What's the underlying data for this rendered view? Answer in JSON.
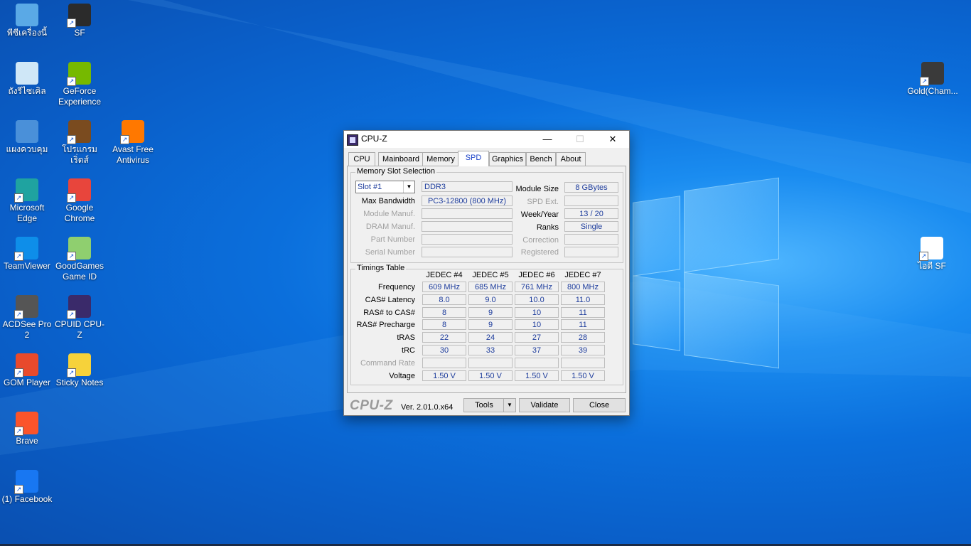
{
  "desktop": {
    "icons": [
      {
        "label": "พีซีเครื่องนี้",
        "icon": "computer-icon"
      },
      {
        "label": "SF",
        "icon": "sf-game-icon"
      },
      {
        "label": "ถังรีไซเคิล",
        "icon": "recycle-bin-icon"
      },
      {
        "label": "GeForce Experience",
        "icon": "geforce-icon"
      },
      {
        "label": "แผงควบคุม",
        "icon": "control-panel-icon"
      },
      {
        "label": "โปรแกรม เริ่ดส์",
        "icon": "program-icon"
      },
      {
        "label": "Avast Free Antivirus",
        "icon": "avast-icon"
      },
      {
        "label": "Microsoft Edge",
        "icon": "edge-icon"
      },
      {
        "label": "Google Chrome",
        "icon": "chrome-icon"
      },
      {
        "label": "TeamViewer",
        "icon": "teamviewer-icon"
      },
      {
        "label": "GoodGames Game ID",
        "icon": "goodgames-icon"
      },
      {
        "label": "ACDSee Pro 2",
        "icon": "acdsee-icon"
      },
      {
        "label": "CPUID CPU-Z",
        "icon": "cpuz-icon"
      },
      {
        "label": "GOM Player",
        "icon": "gom-player-icon"
      },
      {
        "label": "Sticky Notes",
        "icon": "sticky-notes-icon"
      },
      {
        "label": "Brave",
        "icon": "brave-icon"
      },
      {
        "label": "(1) Facebook",
        "icon": "facebook-icon"
      },
      {
        "label": "Gold(Cham...",
        "icon": "gold-game-icon"
      },
      {
        "label": "ไอดี SF",
        "icon": "text-file-icon"
      }
    ]
  },
  "window": {
    "title": "CPU-Z",
    "controls": {
      "minimize": "—",
      "maximize": "☐",
      "close": "✕"
    },
    "tabs": [
      "CPU",
      "Mainboard",
      "Memory",
      "SPD",
      "Graphics",
      "Bench",
      "About"
    ],
    "active_tab": "SPD"
  },
  "slot": {
    "group_title": "Memory Slot Selection",
    "selected": "Slot #1",
    "type": "DDR3",
    "max_bandwidth_label": "Max Bandwidth",
    "max_bandwidth": "PC3-12800 (800 MHz)",
    "module_manuf_label": "Module Manuf.",
    "dram_manuf_label": "DRAM Manuf.",
    "part_number_label": "Part Number",
    "serial_number_label": "Serial Number",
    "module_size_label": "Module Size",
    "module_size": "8 GBytes",
    "spd_ext_label": "SPD Ext.",
    "week_year_label": "Week/Year",
    "week_year": "13 / 20",
    "ranks_label": "Ranks",
    "ranks": "Single",
    "correction_label": "Correction",
    "registered_label": "Registered"
  },
  "timings": {
    "group_title": "Timings Table",
    "columns": [
      "JEDEC #4",
      "JEDEC #5",
      "JEDEC #6",
      "JEDEC #7"
    ],
    "rows": [
      {
        "label": "Frequency",
        "values": [
          "609 MHz",
          "685 MHz",
          "761 MHz",
          "800 MHz"
        ],
        "dim": false
      },
      {
        "label": "CAS# Latency",
        "values": [
          "8.0",
          "9.0",
          "10.0",
          "11.0"
        ],
        "dim": false
      },
      {
        "label": "RAS# to CAS#",
        "values": [
          "8",
          "9",
          "10",
          "11"
        ],
        "dim": false
      },
      {
        "label": "RAS# Precharge",
        "values": [
          "8",
          "9",
          "10",
          "11"
        ],
        "dim": false
      },
      {
        "label": "tRAS",
        "values": [
          "22",
          "24",
          "27",
          "28"
        ],
        "dim": false
      },
      {
        "label": "tRC",
        "values": [
          "30",
          "33",
          "37",
          "39"
        ],
        "dim": false
      },
      {
        "label": "Command Rate",
        "values": [
          "",
          "",
          "",
          ""
        ],
        "dim": true
      },
      {
        "label": "Voltage",
        "values": [
          "1.50 V",
          "1.50 V",
          "1.50 V",
          "1.50 V"
        ],
        "dim": false
      }
    ]
  },
  "footer": {
    "brand": "CPU-Z",
    "version": "Ver. 2.01.0.x64",
    "tools_label": "Tools",
    "validate_label": "Validate",
    "close_label": "Close"
  }
}
